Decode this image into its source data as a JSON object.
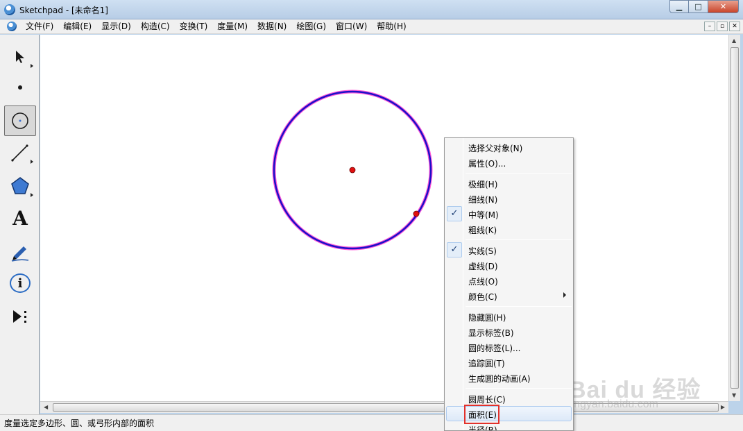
{
  "window": {
    "title": "Sketchpad  - [未命名1]",
    "controls": {
      "minimize": "▁",
      "maximize": "□",
      "close": "✕"
    }
  },
  "menubar": {
    "items": [
      "文件(F)",
      "编辑(E)",
      "显示(D)",
      "构造(C)",
      "变换(T)",
      "度量(M)",
      "数据(N)",
      "绘图(G)",
      "窗口(W)",
      "帮助(H)"
    ],
    "mdi_controls": [
      "–",
      "▫",
      "✕"
    ]
  },
  "toolbox": {
    "tools": [
      {
        "name": "select-arrow-tool",
        "icon": "arrow-pointer-icon",
        "selected": false,
        "has_submenu": true
      },
      {
        "name": "point-tool",
        "icon": "point-icon",
        "selected": false,
        "has_submenu": false
      },
      {
        "name": "compass-tool",
        "icon": "circle-compass-icon",
        "selected": true,
        "has_submenu": false
      },
      {
        "name": "straightedge-tool",
        "icon": "line-segment-icon",
        "selected": false,
        "has_submenu": true
      },
      {
        "name": "polygon-tool",
        "icon": "pentagon-icon",
        "selected": false,
        "has_submenu": true
      },
      {
        "name": "text-tool",
        "icon": "text-a-icon",
        "selected": false,
        "has_submenu": false
      },
      {
        "name": "marker-tool",
        "icon": "pen-marker-icon",
        "selected": false,
        "has_submenu": false
      },
      {
        "name": "information-tool",
        "icon": "info-bubble-icon",
        "selected": false,
        "has_submenu": false
      },
      {
        "name": "custom-tool",
        "icon": "play-custom-icon",
        "selected": false,
        "has_submenu": false
      }
    ],
    "text_glyph": "A",
    "info_glyph": "i"
  },
  "context_menu": {
    "groups": [
      [
        {
          "label": "选择父对象(N)",
          "checked": false
        },
        {
          "label": "属性(O)...",
          "checked": false
        }
      ],
      [
        {
          "label": "极细(H)",
          "checked": false
        },
        {
          "label": "细线(N)",
          "checked": false
        },
        {
          "label": "中等(M)",
          "checked": true
        },
        {
          "label": "粗线(K)",
          "checked": false
        }
      ],
      [
        {
          "label": "实线(S)",
          "checked": true
        },
        {
          "label": "虚线(D)",
          "checked": false
        },
        {
          "label": "点线(O)",
          "checked": false
        },
        {
          "label": "颜色(C)",
          "checked": false,
          "submenu": true
        }
      ],
      [
        {
          "label": "隐藏圆(H)",
          "checked": false
        },
        {
          "label": "显示标签(B)",
          "checked": false
        },
        {
          "label": "圆的标签(L)...",
          "checked": false
        },
        {
          "label": "追踪圆(T)",
          "checked": false
        },
        {
          "label": "生成圆的动画(A)",
          "checked": false
        }
      ],
      [
        {
          "label": "圆周长(C)",
          "checked": false
        },
        {
          "label": "面积(E)",
          "checked": false,
          "hover": true
        },
        {
          "label": "半径(R)",
          "checked": false
        }
      ]
    ],
    "check_glyph": "✓"
  },
  "statusbar": {
    "text": "度量选定多边形、圆、或弓形内部的面积"
  },
  "watermark": {
    "brand": "Bai du 经验",
    "url": "jingyan.baidu.com"
  },
  "colors": {
    "circle_stroke": "#1a10c8",
    "circle_halo": "#ff2fd0",
    "point_fill": "#e01010",
    "highlight_box": "#e2312b"
  }
}
